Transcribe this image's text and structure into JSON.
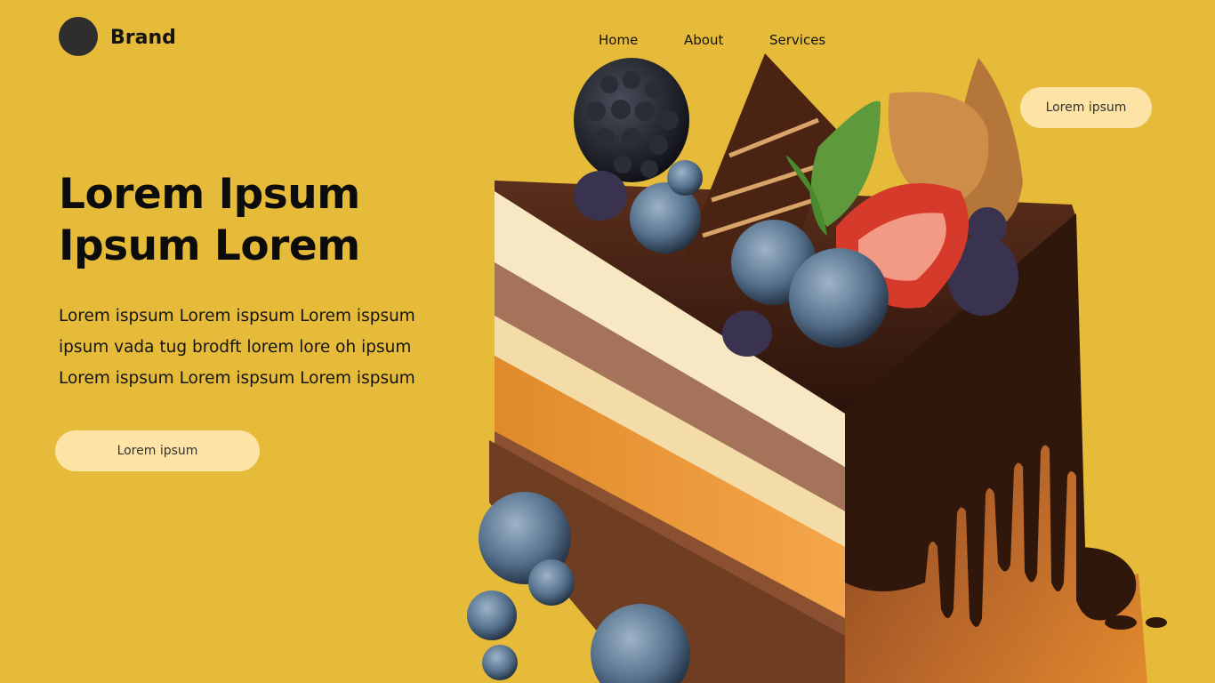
{
  "brand": {
    "name": "Brand"
  },
  "nav": {
    "items": [
      "Home",
      "About",
      "Services"
    ]
  },
  "header": {
    "button_label": "Lorem ipsum"
  },
  "hero": {
    "title": "Lorem Ipsum Ipsum Lorem",
    "description_lines": [
      "Lorem ispsum  Lorem ispsum  Lorem ispsum",
      "ipsum vada tug brodft lorem lore oh ipsum",
      "Lorem ispsum  Lorem ispsum  Lorem ispsum"
    ],
    "cta_label": "Lorem ipsum"
  },
  "image": {
    "subject": "cake-slice-illustration"
  },
  "colors": {
    "background": "#e6bb3a",
    "button": "#fde3a5",
    "logo": "#2e2e2e",
    "text": "#141414"
  }
}
